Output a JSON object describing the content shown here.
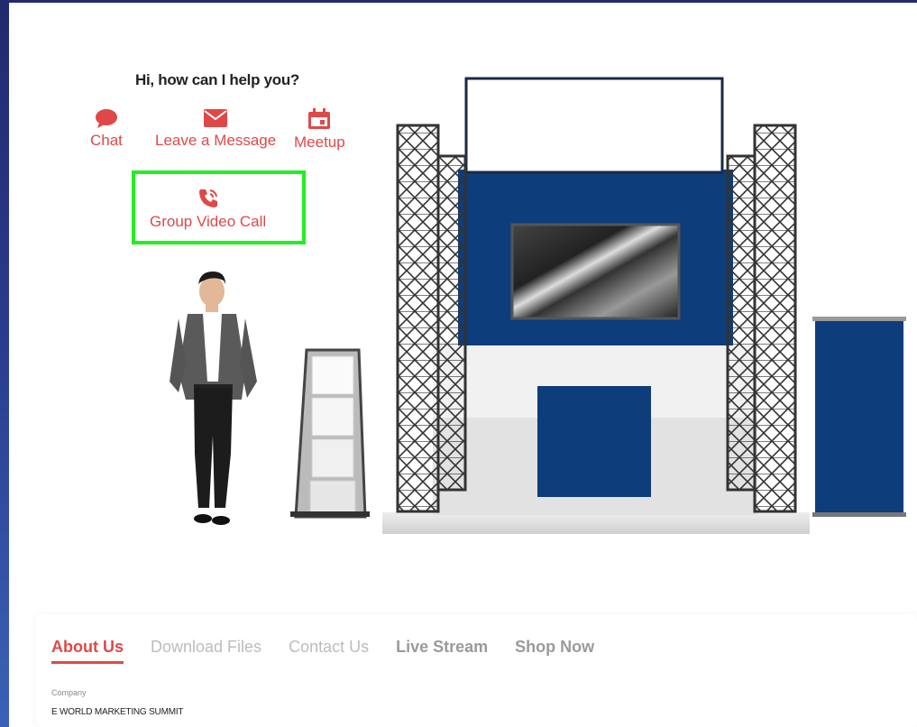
{
  "helper": {
    "title": "Hi, how can I help you?",
    "actions": [
      {
        "label": "Chat",
        "icon": "chat-bubble-icon"
      },
      {
        "label": "Leave a Message",
        "icon": "envelope-icon"
      },
      {
        "label": "Meetup",
        "icon": "calendar-icon"
      },
      {
        "label": "Group Video Call",
        "icon": "phone-call-icon"
      }
    ],
    "accent_color": "#e04848",
    "highlight_color": "#22ee22"
  },
  "booth": {
    "primary_color": "#0d3d7a"
  },
  "tabs": [
    {
      "label": "About Us",
      "active": true
    },
    {
      "label": "Download Files",
      "active": false
    },
    {
      "label": "Contact Us",
      "active": false
    },
    {
      "label": "Live Stream",
      "active": false
    },
    {
      "label": "Shop Now",
      "active": false
    }
  ],
  "company": {
    "label": "Company",
    "name": "E WORLD MARKETING SUMMIT"
  }
}
